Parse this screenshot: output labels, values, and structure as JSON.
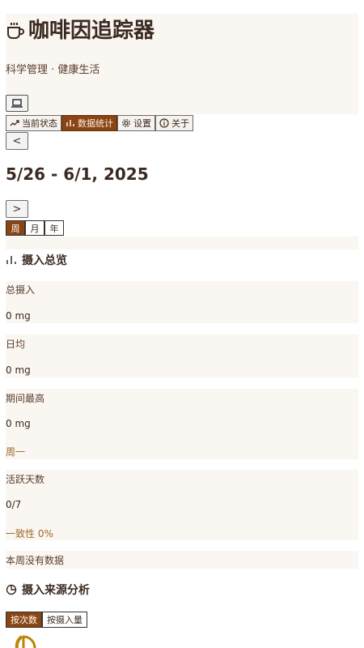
{
  "app": {
    "title": "咖啡因追踪器",
    "subtitle": "科学管理 · 健康生活"
  },
  "tabs": [
    {
      "label": "当前状态",
      "icon": "trend-up-icon",
      "active": false
    },
    {
      "label": "数据统计",
      "icon": "bar-chart-icon",
      "active": true
    },
    {
      "label": "设置",
      "icon": "gear-icon",
      "active": false
    },
    {
      "label": "关于",
      "icon": "info-icon",
      "active": false
    }
  ],
  "date_nav": {
    "prev": "<",
    "next": ">",
    "range": "5/26 - 6/1, 2025"
  },
  "period": {
    "options": [
      "周",
      "月",
      "年"
    ],
    "selected": "周"
  },
  "overview": {
    "title": "摄入总览",
    "total_label": "总摄入",
    "total_value": "0 mg",
    "daily_label": "日均",
    "daily_value": "0 mg",
    "peak_label": "期间最高",
    "peak_value": "0 mg",
    "peak_day": "周一",
    "active_label": "活跃天数",
    "active_value": "0/7",
    "consistency": "一致性 0%"
  },
  "no_data_text": "本周没有数据",
  "source_analysis": {
    "title": "摄入来源分析",
    "options": [
      "按次数",
      "按摄入量"
    ],
    "selected": "按次数"
  },
  "colors": {
    "accent": "#8b4513",
    "band": "#faf6f1",
    "text": "#3b2a22",
    "pie": "#b8860b"
  }
}
